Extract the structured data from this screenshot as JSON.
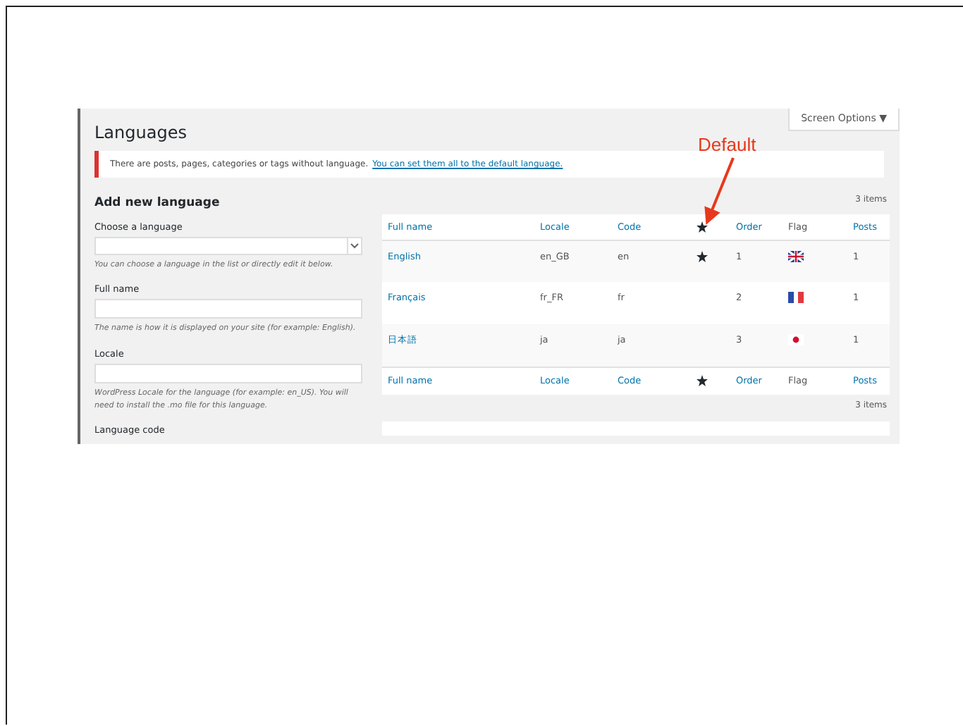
{
  "screen_options": {
    "label": "Screen Options ▼"
  },
  "page_title": "Languages",
  "notice": {
    "text": "There are posts, pages, categories or tags without language.",
    "link": "You can set them all to the default language."
  },
  "form": {
    "title": "Add new language",
    "fields": [
      {
        "kind": "select",
        "label": "Choose a language",
        "help": "You can choose a language in the list or directly edit it below."
      },
      {
        "kind": "text",
        "label": "Full name",
        "help": "The name is how it is displayed on your site (for example: English)."
      },
      {
        "kind": "text",
        "label": "Locale",
        "help": "WordPress Locale for the language (for example: en_US). You will need to install the .mo file for this language."
      },
      {
        "kind": "heading",
        "label": "Language code"
      }
    ]
  },
  "table": {
    "count_top": "3 items",
    "count_bottom": "3 items",
    "columns": [
      {
        "label": "Full name",
        "kind": "link"
      },
      {
        "label": "Locale",
        "kind": "link"
      },
      {
        "label": "Code",
        "kind": "link"
      },
      {
        "kind": "star"
      },
      {
        "label": "Order",
        "kind": "link"
      },
      {
        "label": "Flag",
        "kind": "plain"
      },
      {
        "label": "Posts",
        "kind": "link"
      }
    ],
    "rows": [
      {
        "name": "English",
        "locale": "en_GB",
        "code": "en",
        "default": true,
        "order": "1",
        "flag": {
          "kind": "gb"
        },
        "posts": "1"
      },
      {
        "name": "Français",
        "locale": "fr_FR",
        "code": "fr",
        "default": false,
        "order": "2",
        "flag": {
          "kind": "fr"
        },
        "posts": "1"
      },
      {
        "name": "日本語",
        "locale": "ja",
        "code": "ja",
        "default": false,
        "order": "3",
        "flag": {
          "kind": "jp"
        },
        "posts": "1"
      }
    ],
    "footer_columns": [
      {
        "label": "Full name",
        "kind": "link"
      },
      {
        "label": "Locale",
        "kind": "link"
      },
      {
        "label": "Code",
        "kind": "link"
      },
      {
        "kind": "star"
      },
      {
        "label": "Order",
        "kind": "link"
      },
      {
        "label": "Flag",
        "kind": "plain"
      },
      {
        "label": "Posts",
        "kind": "link"
      }
    ]
  },
  "annotation": {
    "text": "Default"
  }
}
